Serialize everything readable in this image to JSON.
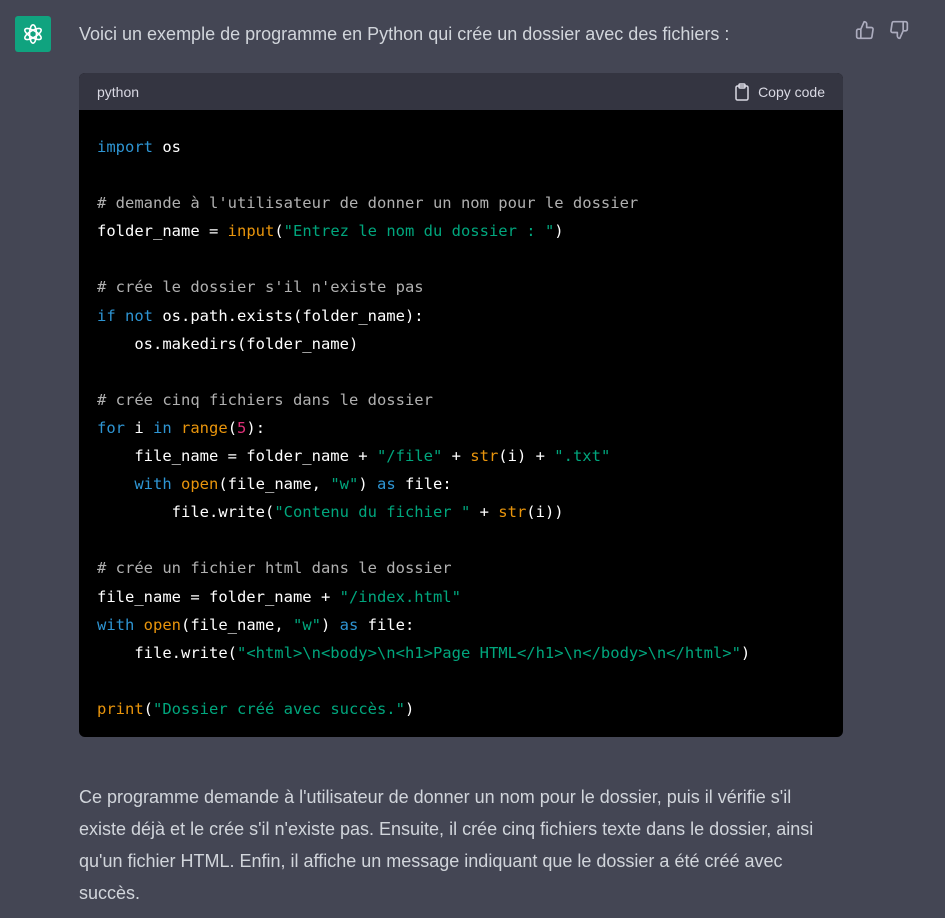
{
  "avatar": {
    "icon": "openai-logo-icon",
    "color": "#10a37f"
  },
  "message": {
    "intro": "Voici un exemple de programme en Python qui crée un dossier avec des fichiers :",
    "outro": "Ce programme demande à l'utilisateur de donner un nom pour le dossier, puis il vérifie s'il existe déjà et le crée s'il n'existe pas. Ensuite, il crée cinq fichiers texte dans le dossier, ainsi qu'un fichier HTML. Enfin, il affiche un message indiquant que le dossier a été créé avec succès."
  },
  "feedback": {
    "up_icon": "thumbs-up-icon",
    "down_icon": "thumbs-down-icon"
  },
  "code_block": {
    "language": "python",
    "copy_label": "Copy code",
    "copy_icon": "clipboard-icon",
    "lines": [
      [
        {
          "t": "kw",
          "v": "import"
        },
        {
          "t": "p",
          "v": " os"
        }
      ],
      [],
      [
        {
          "t": "cm",
          "v": "# demande à l'utilisateur de donner un nom pour le dossier"
        }
      ],
      [
        {
          "t": "p",
          "v": "folder_name = "
        },
        {
          "t": "bi",
          "v": "input"
        },
        {
          "t": "p",
          "v": "("
        },
        {
          "t": "st",
          "v": "\"Entrez le nom du dossier : \""
        },
        {
          "t": "p",
          "v": ")"
        }
      ],
      [],
      [
        {
          "t": "cm",
          "v": "# crée le dossier s'il n'existe pas"
        }
      ],
      [
        {
          "t": "kw",
          "v": "if"
        },
        {
          "t": "p",
          "v": " "
        },
        {
          "t": "kw",
          "v": "not"
        },
        {
          "t": "p",
          "v": " os.path.exists(folder_name):"
        }
      ],
      [
        {
          "t": "p",
          "v": "    os.makedirs(folder_name)"
        }
      ],
      [],
      [
        {
          "t": "cm",
          "v": "# crée cinq fichiers dans le dossier"
        }
      ],
      [
        {
          "t": "kw",
          "v": "for"
        },
        {
          "t": "p",
          "v": " i "
        },
        {
          "t": "kw",
          "v": "in"
        },
        {
          "t": "p",
          "v": " "
        },
        {
          "t": "bi",
          "v": "range"
        },
        {
          "t": "p",
          "v": "("
        },
        {
          "t": "nm",
          "v": "5"
        },
        {
          "t": "p",
          "v": "):"
        }
      ],
      [
        {
          "t": "p",
          "v": "    file_name = folder_name + "
        },
        {
          "t": "st",
          "v": "\"/file\""
        },
        {
          "t": "p",
          "v": " + "
        },
        {
          "t": "bi",
          "v": "str"
        },
        {
          "t": "p",
          "v": "(i) + "
        },
        {
          "t": "st",
          "v": "\".txt\""
        }
      ],
      [
        {
          "t": "p",
          "v": "    "
        },
        {
          "t": "kw",
          "v": "with"
        },
        {
          "t": "p",
          "v": " "
        },
        {
          "t": "bi",
          "v": "open"
        },
        {
          "t": "p",
          "v": "(file_name, "
        },
        {
          "t": "st",
          "v": "\"w\""
        },
        {
          "t": "p",
          "v": ") "
        },
        {
          "t": "kw",
          "v": "as"
        },
        {
          "t": "p",
          "v": " file:"
        }
      ],
      [
        {
          "t": "p",
          "v": "        file.write("
        },
        {
          "t": "st",
          "v": "\"Contenu du fichier \""
        },
        {
          "t": "p",
          "v": " + "
        },
        {
          "t": "bi",
          "v": "str"
        },
        {
          "t": "p",
          "v": "(i))"
        }
      ],
      [],
      [
        {
          "t": "cm",
          "v": "# crée un fichier html dans le dossier"
        }
      ],
      [
        {
          "t": "p",
          "v": "file_name = folder_name + "
        },
        {
          "t": "st",
          "v": "\"/index.html\""
        }
      ],
      [
        {
          "t": "kw",
          "v": "with"
        },
        {
          "t": "p",
          "v": " "
        },
        {
          "t": "bi",
          "v": "open"
        },
        {
          "t": "p",
          "v": "(file_name, "
        },
        {
          "t": "st",
          "v": "\"w\""
        },
        {
          "t": "p",
          "v": ") "
        },
        {
          "t": "kw",
          "v": "as"
        },
        {
          "t": "p",
          "v": " file:"
        }
      ],
      [
        {
          "t": "p",
          "v": "    file.write("
        },
        {
          "t": "st",
          "v": "\"<html>\\n<body>\\n<h1>Page HTML</h1>\\n</body>\\n</html>\""
        },
        {
          "t": "p",
          "v": ")"
        }
      ],
      [],
      [
        {
          "t": "bi",
          "v": "print"
        },
        {
          "t": "p",
          "v": "("
        },
        {
          "t": "st",
          "v": "\"Dossier créé avec succès.\""
        },
        {
          "t": "p",
          "v": ")"
        }
      ]
    ]
  }
}
